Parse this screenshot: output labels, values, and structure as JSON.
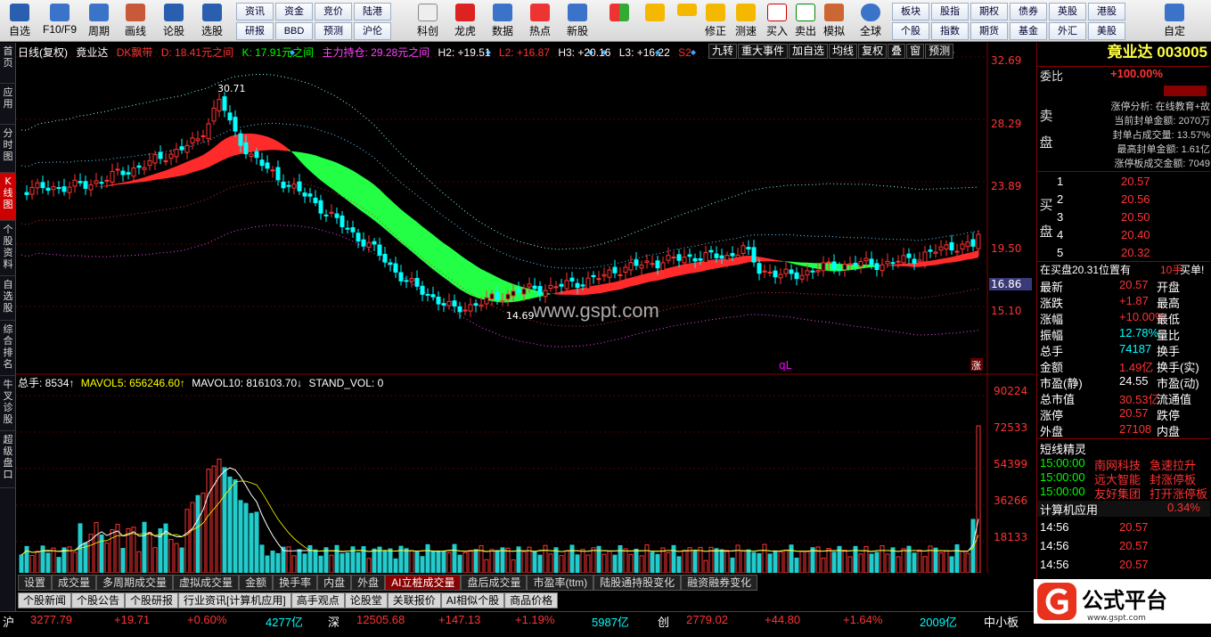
{
  "toolbar": {
    "buttons": [
      {
        "label": "自选",
        "icon": "star-icon"
      },
      {
        "label": "F10/F9",
        "icon": "f10-icon"
      },
      {
        "label": "周期",
        "icon": "period-icon"
      },
      {
        "label": "画线",
        "icon": "pen-icon"
      },
      {
        "label": "论股",
        "icon": "discuss-icon"
      },
      {
        "label": "选股",
        "icon": "select-stock-icon"
      }
    ],
    "grid1": [
      "资讯",
      "资金",
      "竞价",
      "陆港",
      "研报",
      "BBD",
      "预测",
      "沪伦"
    ],
    "buttons2": [
      "科创",
      "龙虎",
      "数据",
      "热点",
      "新股"
    ],
    "buttons3": [
      "修正",
      "测速",
      "买入",
      "卖出",
      "模拟",
      "全球"
    ],
    "grid2": [
      "板块",
      "股指",
      "期权",
      "债券",
      "英股",
      "港股",
      "个股",
      "指数",
      "期货",
      "基金",
      "外汇",
      "美股"
    ],
    "custom_label": "自定"
  },
  "leftnav": [
    "首页",
    "应用",
    "分时图",
    "K线图",
    "个股资料",
    "自选股",
    "综合排名",
    "牛叉诊股",
    "超级盘口"
  ],
  "info": {
    "period": "日线(复权)",
    "name": "竟业达",
    "dk": "DK飘带",
    "d": "D: 18.41元之间",
    "k": "K: 17.91元之间",
    "main": "主力持仓: 29.28元之间",
    "h2": "H2: +19.51",
    "l2": "L2: +16.87",
    "h3": "H3: +20.16",
    "l3": "L3: +16.22",
    "s": "S2"
  },
  "mid_tabs": [
    "九转",
    "重大事件",
    "加自选",
    "均线",
    "复权",
    "叠",
    "窗",
    "预测"
  ],
  "price_axis": [
    "32.69",
    "28.29",
    "23.89",
    "19.50",
    "15.10"
  ],
  "price_marker": "16.86",
  "annot": {
    "high": "30.71",
    "low": "14.69",
    "watermark": "www.gspt.com",
    "ql": "qL",
    "zhang": "涨"
  },
  "vol_info": {
    "total": "总手: 8534↑",
    "ma5": "MAVOL5: 656246.60↑",
    "ma10": "MAVOL10: 816103.70↓",
    "stand": "STAND_VOL: 0"
  },
  "vol_axis": [
    "90224",
    "72533",
    "54399",
    "36266",
    "18133"
  ],
  "bottom_tabs": [
    "设置",
    "成交量",
    "多周期成交量",
    "虚拟成交量",
    "金额",
    "换手率",
    "内盘",
    "外盘",
    "AI立桩成交量",
    "盘后成交量",
    "市盈率(ttm)",
    "陆股通持股变化",
    "融资融券变化"
  ],
  "news_tabs": [
    "个股新闻",
    "个股公告",
    "个股研报",
    "行业资讯[计算机应用]",
    "高手观点",
    "论股堂",
    "关联报价",
    "AI相似个股",
    "商品价格"
  ],
  "status": {
    "sh_label": "沪",
    "sh_val": "3277.79",
    "sh_chg": "+19.71",
    "sh_pct": "+0.60%",
    "sh_amt": "4277亿",
    "sz_label": "深",
    "sz_val": "12505.68",
    "sz_chg": "+147.13",
    "sz_pct": "+1.19%",
    "sz_amt": "5987亿",
    "cy_label": "创",
    "cy_val": "2779.02",
    "cy_chg": "+44.80",
    "cy_pct": "+1.64%",
    "cy_amt": "2009亿",
    "zx_label": "中小板"
  },
  "right_panel": {
    "title": "竟业达 003005",
    "weibi_label": "委比",
    "weibi": "+100.00%",
    "sell_label": "卖盘",
    "buy_label": "买盘",
    "limit_lines": [
      "涨停分析: 在线教育+故",
      "当前封单金额: 2070万",
      "封单占成交量: 13.57%",
      "最高封单金额: 1.61亿",
      "涨停板成交金额: 7049"
    ],
    "bids": [
      [
        "1",
        "20.57"
      ],
      [
        "2",
        "20.56"
      ],
      [
        "3",
        "20.50"
      ],
      [
        "4",
        "20.40"
      ],
      [
        "5",
        "20.32"
      ]
    ],
    "bid_note": "在买盘20.31位置有",
    "bid_note_amt": "10手",
    "bid_note_end": "买单!",
    "quote": [
      [
        "最新",
        "20.57",
        "开盘",
        ""
      ],
      [
        "涨跌",
        "+1.87",
        "最高",
        ""
      ],
      [
        "涨幅",
        "+10.00%",
        "最低",
        ""
      ],
      [
        "振幅",
        "12.78%",
        "量比",
        ""
      ],
      [
        "总手",
        "74187",
        "换手",
        ""
      ],
      [
        "金额",
        "1.49亿",
        "换手(实)",
        ""
      ],
      [
        "市盈(静)",
        "24.55",
        "市盈(动)",
        ""
      ],
      [
        "总市值",
        "30.53亿",
        "流通值",
        ""
      ],
      [
        "涨停",
        "20.57",
        "跌停",
        ""
      ],
      [
        "外盘",
        "27108",
        "内盘",
        ""
      ]
    ],
    "elf_title": "短线精灵",
    "elf": [
      [
        "15:00:00",
        "南网科技",
        "急速拉升"
      ],
      [
        "15:00:00",
        "远大智能",
        "封涨停板"
      ],
      [
        "15:00:00",
        "友好集团",
        "打开涨停板"
      ]
    ],
    "industry": "计算机应用",
    "industry_pct": "0.34%",
    "ticks": [
      [
        "14:56",
        "20.57"
      ],
      [
        "14:56",
        "20.57"
      ],
      [
        "14:56",
        "20.57"
      ]
    ]
  },
  "logo_text": "公式平台",
  "logo_url": "www.gspt.com",
  "colors": {
    "up": "#ff3333",
    "down": "#00ffff",
    "ribbon_up": "#ff2a2a",
    "ribbon_down": "#22ff44",
    "accent": "#ffff00"
  }
}
